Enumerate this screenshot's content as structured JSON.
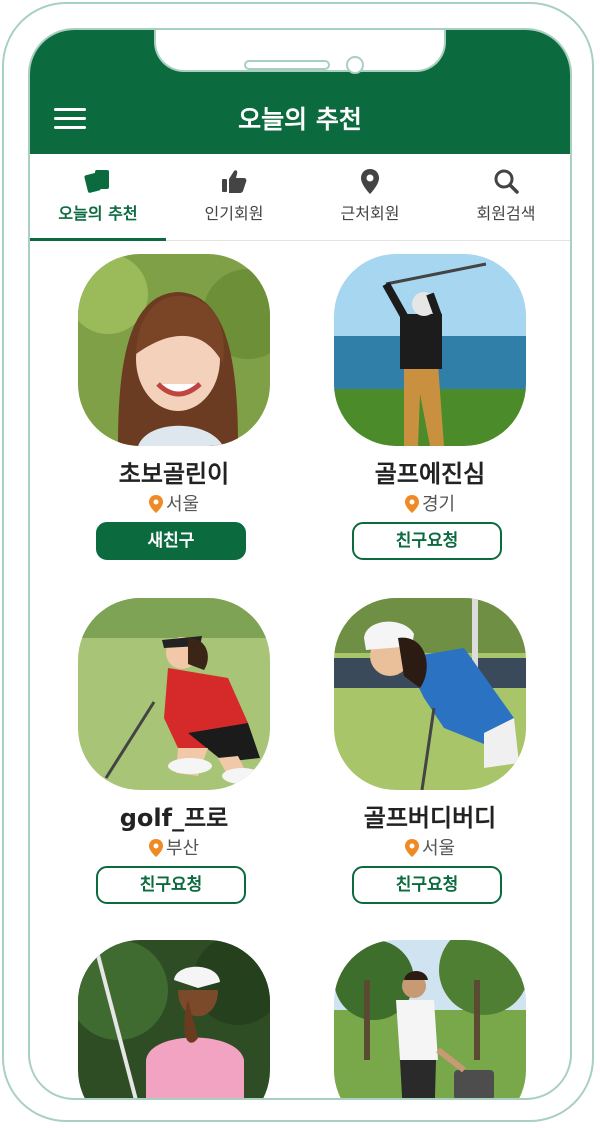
{
  "header": {
    "title": "오늘의 추천",
    "menu_icon": "hamburger-menu-icon",
    "background": "#0b6b3f"
  },
  "tabs": [
    {
      "label": "오늘의 추천",
      "icon": "cards-icon",
      "active": true
    },
    {
      "label": "인기회원",
      "icon": "thumbs-up-icon",
      "active": false
    },
    {
      "label": "근처회원",
      "icon": "location-pin-icon",
      "active": false
    },
    {
      "label": "회원검색",
      "icon": "search-icon",
      "active": false
    }
  ],
  "members": [
    {
      "name": "초보골린이",
      "location": "서울",
      "button": "새친구",
      "button_style": "filled"
    },
    {
      "name": "골프에진심",
      "location": "경기",
      "button": "친구요청",
      "button_style": "outline"
    },
    {
      "name": "golf_프로",
      "location": "부산",
      "button": "친구요청",
      "button_style": "outline"
    },
    {
      "name": "골프버디버디",
      "location": "서울",
      "button": "친구요청",
      "button_style": "outline"
    },
    {
      "name": "",
      "location": "",
      "button": "",
      "button_style": "outline"
    },
    {
      "name": "",
      "location": "",
      "button": "",
      "button_style": "outline"
    }
  ],
  "colors": {
    "accent": "#0b6b3f",
    "pin": "#f08a24",
    "frame": "#a9cfc0"
  }
}
